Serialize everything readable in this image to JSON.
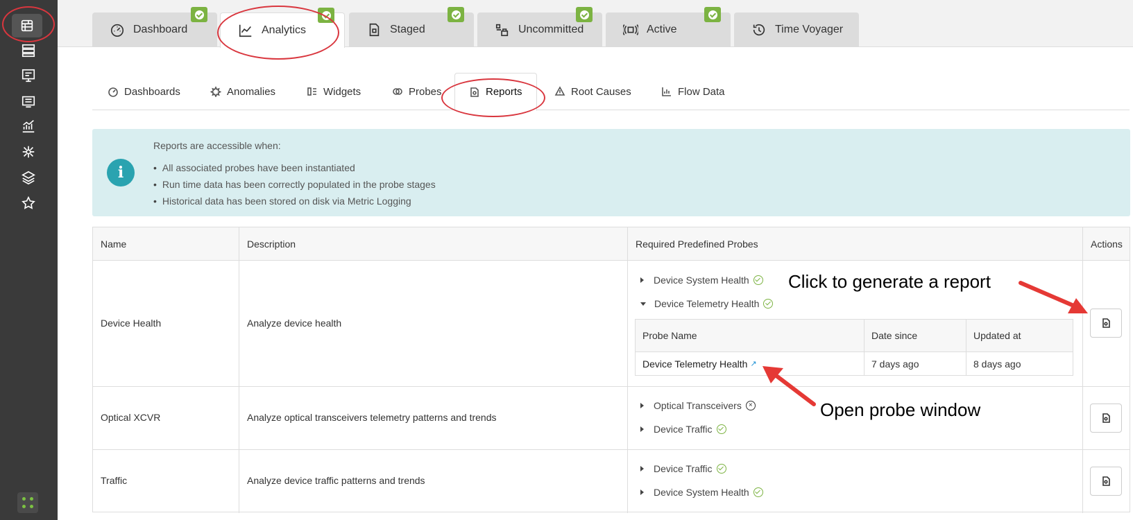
{
  "top_tabs": [
    {
      "label": "Dashboard",
      "icon": "gauge-icon",
      "badge": true
    },
    {
      "label": "Analytics",
      "icon": "line-chart-icon",
      "badge": true
    },
    {
      "label": "Staged",
      "icon": "staged-doc-icon",
      "badge": true
    },
    {
      "label": "Uncommitted",
      "icon": "uncommitted-icon",
      "badge": true
    },
    {
      "label": "Active",
      "icon": "active-signal-icon",
      "badge": true
    },
    {
      "label": "Time Voyager",
      "icon": "history-icon",
      "badge": false
    }
  ],
  "sub_tabs": [
    {
      "label": "Dashboards"
    },
    {
      "label": "Anomalies"
    },
    {
      "label": "Widgets"
    },
    {
      "label": "Probes"
    },
    {
      "label": "Reports"
    },
    {
      "label": "Root Causes"
    },
    {
      "label": "Flow Data"
    }
  ],
  "info": {
    "title": "Reports are accessible when:",
    "items": [
      "All associated probes have been instantiated",
      "Run time data has been correctly populated in the probe stages",
      "Historical data has been stored on disk via Metric Logging"
    ]
  },
  "table": {
    "headers": [
      "Name",
      "Description",
      "Required Predefined Probes",
      "Actions"
    ],
    "rows": [
      {
        "name": "Device Health",
        "description": "Analyze device health",
        "probes": [
          {
            "label": "Device System Health",
            "status": "ok",
            "expanded": false
          },
          {
            "label": "Device Telemetry Health",
            "status": "ok",
            "expanded": true
          }
        ],
        "sub_table": {
          "headers": [
            "Probe Name",
            "Date since",
            "Updated at"
          ],
          "row": [
            "Device Telemetry Health",
            "7 days ago",
            "8 days ago"
          ]
        }
      },
      {
        "name": "Optical XCVR",
        "description": "Analyze optical transceivers telemetry patterns and trends",
        "probes": [
          {
            "label": "Optical Transceivers",
            "status": "error",
            "expanded": false
          },
          {
            "label": "Device Traffic",
            "status": "ok",
            "expanded": false
          }
        ]
      },
      {
        "name": "Traffic",
        "description": "Analyze device traffic patterns and trends",
        "probes": [
          {
            "label": "Device Traffic",
            "status": "ok",
            "expanded": false
          },
          {
            "label": "Device System Health",
            "status": "ok",
            "expanded": false
          }
        ]
      }
    ]
  },
  "annotations": {
    "generate": "Click to generate a report",
    "open_probe": "Open probe window"
  },
  "colors": {
    "accent": "#7cb342",
    "sidebar": "#3a3a3a",
    "info_bg": "#d9eef0",
    "annotation": "#d9363e"
  }
}
